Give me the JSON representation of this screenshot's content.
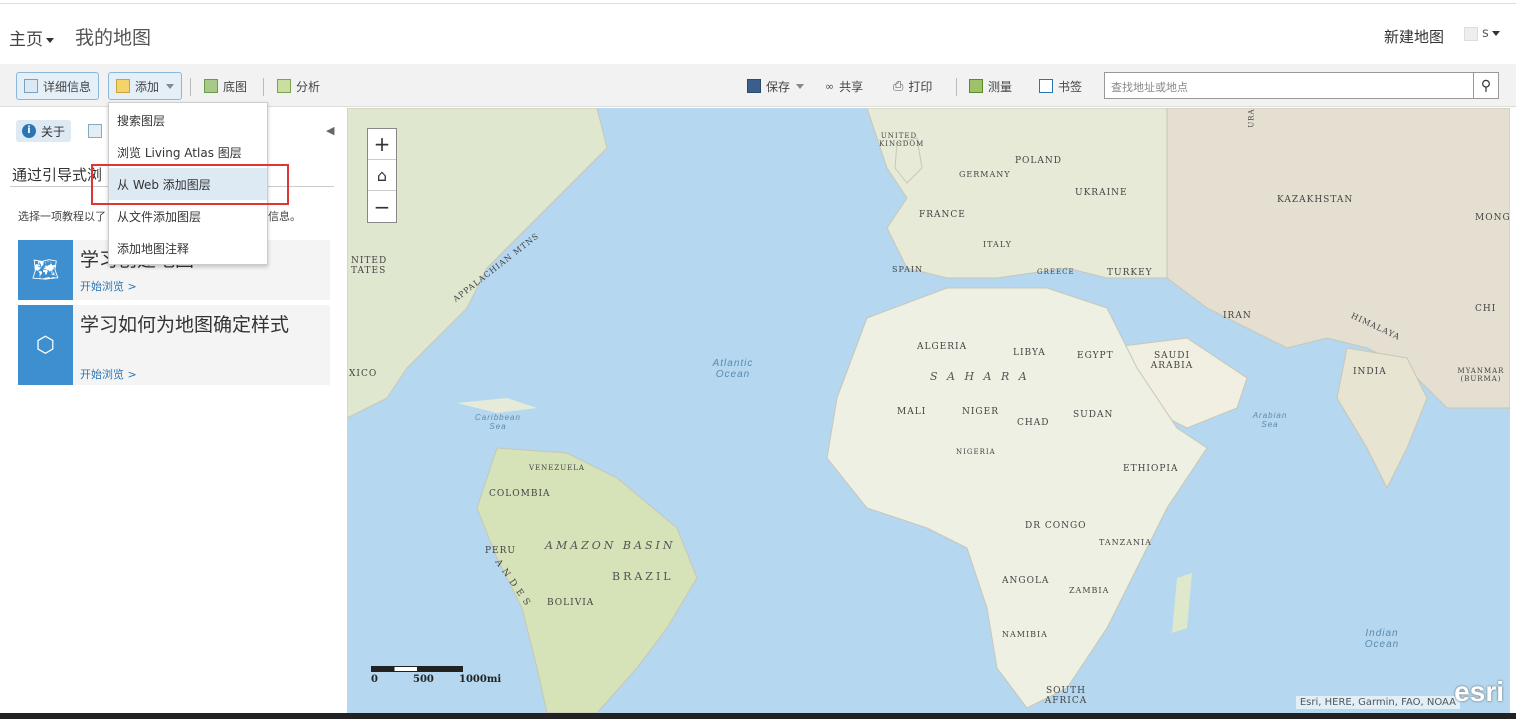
{
  "header": {
    "home_label": "主页",
    "page_title": "我的地图",
    "new_map_label": "新建地图",
    "user_label": "s"
  },
  "toolbar": {
    "details_label": "详细信息",
    "add_label": "添加",
    "basemap_label": "底图",
    "analysis_label": "分析",
    "save_label": "保存",
    "share_label": "共享",
    "print_label": "打印",
    "measure_label": "测量",
    "bookmarks_label": "书签",
    "search_placeholder": "查找地址或地点"
  },
  "add_menu": {
    "items": [
      {
        "label": "搜索图层"
      },
      {
        "label": "浏览 Living Atlas 图层"
      },
      {
        "label": "从 Web 添加图层"
      },
      {
        "label": "从文件添加图层"
      },
      {
        "label": "添加地图注释"
      }
    ],
    "selected_index": 2
  },
  "panel": {
    "about_tab": "关于",
    "guide_title": "通过引导式浏",
    "guide_desc_left": "选择一项教程以了",
    "guide_desc_right": "信息。",
    "cards": [
      {
        "title": "学习创建地图",
        "link": "开始浏览 >"
      },
      {
        "title": "学习如何为地图确定样式",
        "link": "开始浏览 >"
      }
    ]
  },
  "map": {
    "labels": {
      "uk": "UNITED KINGDOM",
      "poland": "POLAND",
      "germany": "GERMANY",
      "ukraine": "UKRAINE",
      "france": "FRANCE",
      "italy": "ITALY",
      "spain": "SPAIN",
      "greece": "GREECE",
      "turkey": "TURKEY",
      "kazakhstan": "KAZAKHSTAN",
      "mongolia": "MONG",
      "china": "CHI",
      "iran": "IRAN",
      "himalaya": "HIMALAYA",
      "india": "INDIA",
      "myanmar": "MYANMAR (BURMA)",
      "algeria": "ALGERIA",
      "libya": "LIBYA",
      "egypt": "EGYPT",
      "saudi": "SAUDI ARABIA",
      "sahara": "S A H A R A",
      "mali": "MALI",
      "niger": "NIGER",
      "chad": "CHAD",
      "sudan": "SUDAN",
      "nigeria": "NIGERIA",
      "ethiopia": "ETHIOPIA",
      "drcongo": "DR CONGO",
      "tanzania": "TANZANIA",
      "angola": "ANGOLA",
      "zambia": "ZAMBIA",
      "namibia": "NAMIBIA",
      "southafrica": "SOUTH AFRICA",
      "us": "NITED TATES",
      "mexico": "XICO",
      "appalachian": "APPALACHIAN MTNS",
      "venezuela": "VENEZUELA",
      "colombia": "COLOMBIA",
      "peru": "PERU",
      "amazon": "AMAZON BASIN",
      "brazil": "BRAZIL",
      "bolivia": "BOLIVIA",
      "andes": "A N D E S",
      "ural": "URA",
      "atlantic": "Atlantic Ocean",
      "caribbean": "Caribbean Sea",
      "arabian": "Arabian Sea",
      "indian": "Indian Ocean"
    },
    "scale_labels": [
      "0",
      "500",
      "1000mi"
    ],
    "attribution": "Esri, HERE, Garmin, FAO, NOAA",
    "logo": "esri"
  }
}
